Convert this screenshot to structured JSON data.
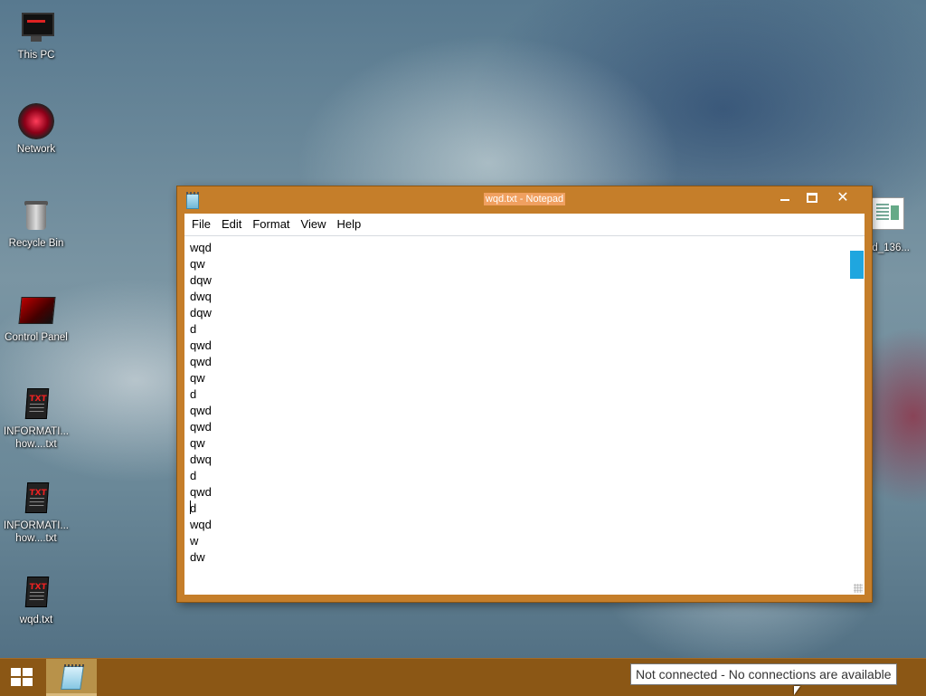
{
  "desktop": {
    "icons": [
      {
        "label": "This PC"
      },
      {
        "label": "Network"
      },
      {
        "label": "Recycle Bin"
      },
      {
        "label": "Control Panel"
      },
      {
        "label": "INFORMATI... how....txt",
        "line1": "INFORMATI...",
        "line2": "how....txt",
        "badge": "TXT"
      },
      {
        "label": "INFORMATI... how....txt",
        "line1": "INFORMATI...",
        "line2": "how....txt",
        "badge": "TXT"
      },
      {
        "label": "wqd.txt",
        "badge": "TXT"
      }
    ],
    "right_icon_label": "ad_136..."
  },
  "notepad": {
    "title": "wqd.txt - Notepad",
    "menu": [
      "File",
      "Edit",
      "Format",
      "View",
      "Help"
    ],
    "lines": [
      "wqd",
      "qw",
      "dqw",
      "dwq",
      "dqw",
      "d",
      "qwd",
      "qwd",
      "qw",
      "d",
      "qwd",
      "qwd",
      "qw",
      "dwq",
      "d",
      "qwd",
      "d",
      "wqd",
      "w",
      "dw"
    ],
    "caret_line": 16,
    "controls": {
      "minimize": "minimize-icon",
      "maximize": "maximize-icon",
      "close": "✕"
    }
  },
  "taskbar": {
    "start_icon": "windows-logo-icon",
    "pinned_app": "notepad-icon",
    "accent": "#8b5715"
  },
  "notification": {
    "text": "Not connected - No connections are available"
  },
  "colors": {
    "window_frame": "#c57e2a",
    "taskbar": "#8b5715",
    "scroll_thumb": "#1fa6df"
  }
}
